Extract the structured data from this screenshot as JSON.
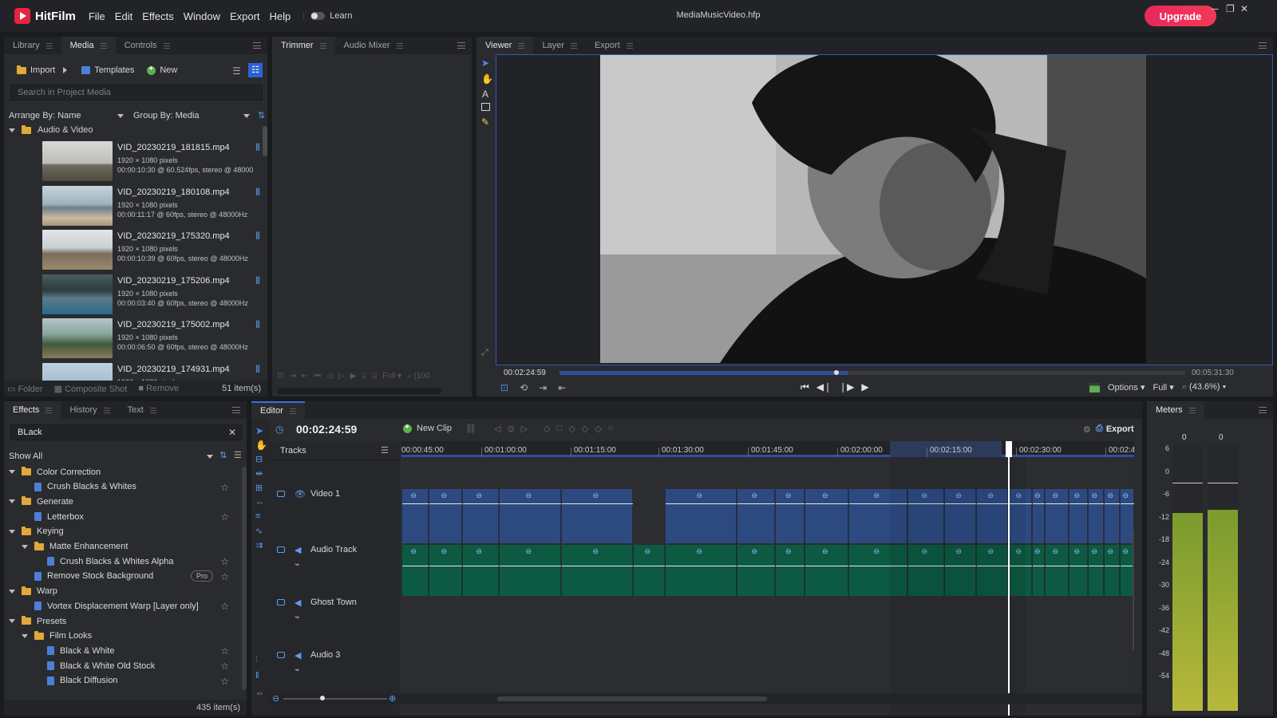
{
  "app": {
    "name": "HitFilm",
    "project_title": "MediaMusicVideo.hfp",
    "upgrade_label": "Upgrade",
    "learn_label": "Learn",
    "menu": [
      "File",
      "Edit",
      "Effects",
      "Window",
      "Export",
      "Help"
    ]
  },
  "colors": {
    "accent": "#e8233f",
    "upgrade": "#f0305a",
    "video_track": "#2d4a80",
    "audio_track": "#0d5a43",
    "playhead": "#ffffff",
    "meter_top": "#7a9b2e",
    "meter_bottom": "#b7b83a"
  },
  "media_panel": {
    "tabs": [
      "Library",
      "Media",
      "Controls"
    ],
    "import_label": "Import",
    "templates_label": "Templates",
    "new_label": "New",
    "search_placeholder": "Search in Project Media",
    "arrange_by": "Arrange By: Name",
    "group_by": "Group By: Media",
    "folder_label": "Audio & Video",
    "items": [
      {
        "name": "VID_20230219_181815.mp4",
        "res": "1920 × 1080 pixels",
        "info": "00:00:10:30 @ 60.524fps, stereo @ 48000"
      },
      {
        "name": "VID_20230219_180108.mp4",
        "res": "1920 × 1080 pixels",
        "info": "00:00:11:17 @ 60fps, stereo @ 48000Hz"
      },
      {
        "name": "VID_20230219_175320.mp4",
        "res": "1920 × 1080 pixels",
        "info": "00:00:10:39 @ 60fps, stereo @ 48000Hz"
      },
      {
        "name": "VID_20230219_175206.mp4",
        "res": "1920 × 1080 pixels",
        "info": "00:00:03:40 @ 60fps, stereo @ 48000Hz"
      },
      {
        "name": "VID_20230219_175002.mp4",
        "res": "1920 × 1080 pixels",
        "info": "00:00:06:50 @ 60fps, stereo @ 48000Hz"
      },
      {
        "name": "VID_20230219_174931.mp4",
        "res": "1920 × 1080 pixels",
        "info": ""
      }
    ],
    "footer": {
      "folder": "Folder",
      "composite": "Composite Shot",
      "remove": "Remove",
      "count": "51 item(s)"
    }
  },
  "trimmer": {
    "tabs": [
      "Trimmer",
      "Audio Mixer"
    ],
    "quality": "Full",
    "zoom": "(100"
  },
  "viewer": {
    "tabs": [
      "Viewer",
      "Layer",
      "Export"
    ],
    "current_time": "00:02:24:59",
    "end_time": "00:05:31:30",
    "scrub_position": 0.46,
    "options_label": "Options",
    "quality": "Full",
    "zoom": "(43.6%)"
  },
  "effects_panel": {
    "tabs": [
      "Effects",
      "History",
      "Text"
    ],
    "search_value": "BLack",
    "filter": "Show All",
    "tree": [
      {
        "label": "Color Correction",
        "kind": "folder",
        "level": 0
      },
      {
        "label": "Crush Blacks & Whites",
        "kind": "effect",
        "level": 1
      },
      {
        "label": "Generate",
        "kind": "folder",
        "level": 0
      },
      {
        "label": "Letterbox",
        "kind": "effect",
        "level": 1
      },
      {
        "label": "Keying",
        "kind": "folder",
        "level": 0
      },
      {
        "label": "Matte Enhancement",
        "kind": "folder",
        "level": 1
      },
      {
        "label": "Crush Blacks & Whites Alpha",
        "kind": "effect",
        "level": 2
      },
      {
        "label": "Remove Stock Background",
        "kind": "effect",
        "level": 1,
        "badge": "Pro"
      },
      {
        "label": "Warp",
        "kind": "folder",
        "level": 0
      },
      {
        "label": "Vortex Displacement Warp [Layer only]",
        "kind": "effect",
        "level": 1
      },
      {
        "label": "Presets",
        "kind": "folder",
        "level": 0
      },
      {
        "label": "Film Looks",
        "kind": "folder",
        "level": 1
      },
      {
        "label": "Black & White",
        "kind": "effect",
        "level": 2
      },
      {
        "label": "Black & White Old Stock",
        "kind": "effect",
        "level": 2
      },
      {
        "label": "Black Diffusion",
        "kind": "effect",
        "level": 2
      }
    ],
    "count": "435 item(s)"
  },
  "editor": {
    "tab": "Editor",
    "timecode": "00:02:24:59",
    "new_clip_label": "New Clip",
    "export_label": "Export",
    "tracks_label": "Tracks",
    "ruler": [
      "00:00:45:00",
      "00:01:00:00",
      "00:01:15:00",
      "00:01:30:00",
      "00:01:45:00",
      "00:02:00:00",
      "00:02:15:00",
      "00:02:30:00",
      "00:02:4"
    ],
    "tracks": [
      {
        "name": "Video 1",
        "type": "video"
      },
      {
        "name": "Audio Track",
        "type": "audio"
      },
      {
        "name": "Ghost Town",
        "type": "audio"
      },
      {
        "name": "Audio 3",
        "type": "audio"
      }
    ]
  },
  "meters": {
    "tab": "Meters",
    "peaks": [
      "0",
      "0"
    ],
    "scale": [
      "6",
      "0",
      "-6",
      "-12",
      "-18",
      "-24",
      "-30",
      "-36",
      "-42",
      "-48",
      "-54"
    ]
  }
}
